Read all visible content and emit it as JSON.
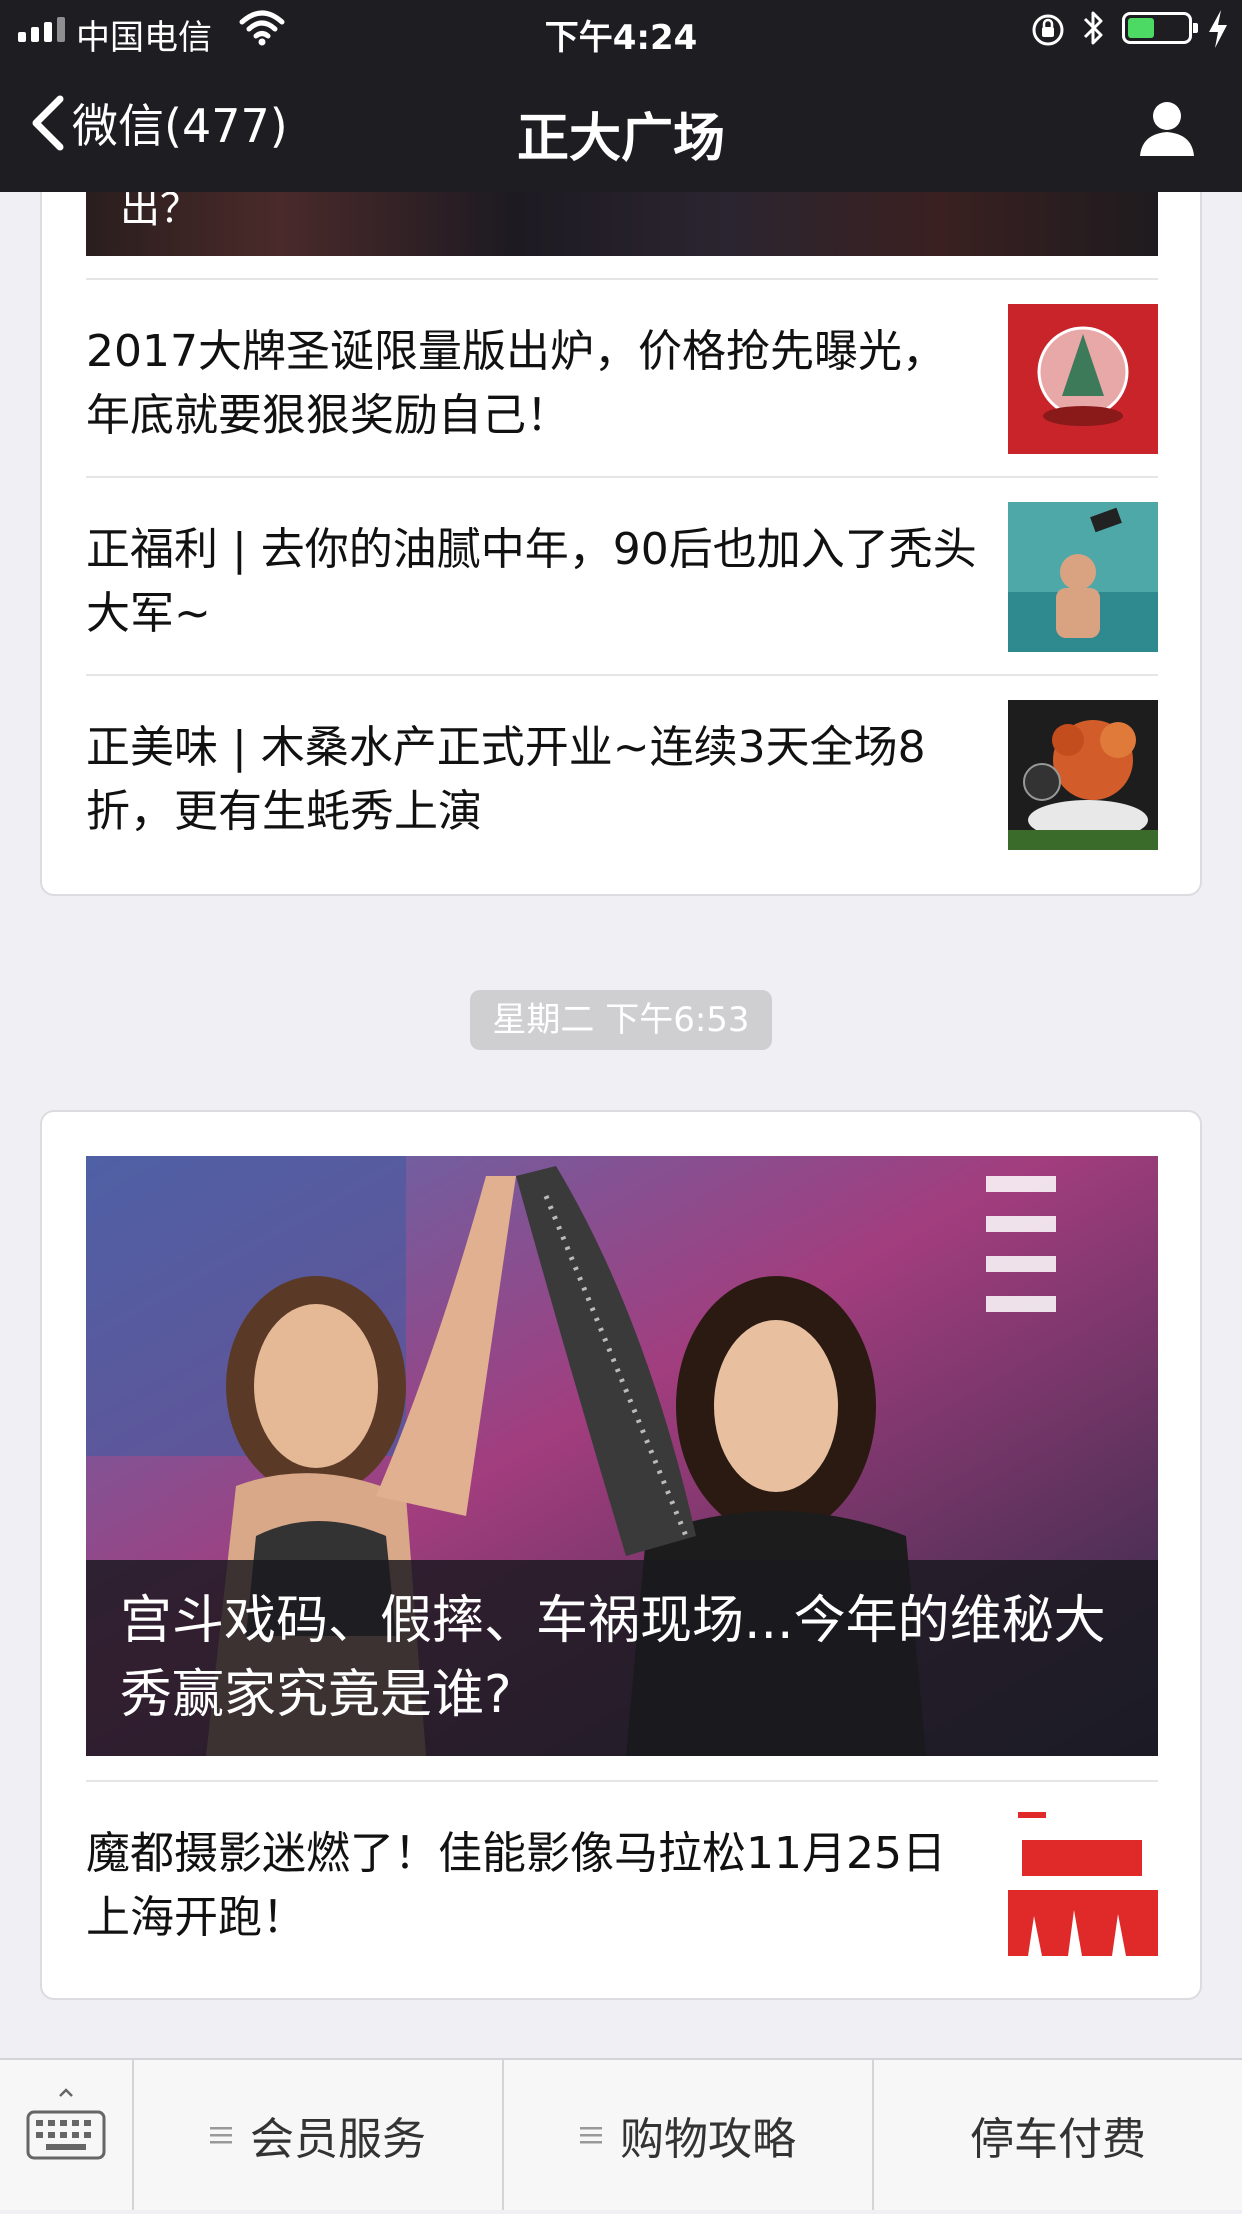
{
  "status_bar": {
    "carrier": "中国电信",
    "time": "下午4:24",
    "battery_level": 0.45
  },
  "nav": {
    "back_label": "微信(477)",
    "title": "正大广场"
  },
  "feed": {
    "card1": {
      "top_truncated": "出？",
      "items": [
        {
          "title": "2017大牌圣诞限量版出炉，价格抢先曝光，年底就要狠狠奖励自己！"
        },
        {
          "title": "正福利 | 去你的油腻中年，90后也加入了秃头大军~"
        },
        {
          "title": "正美味 | 木桑水产正式开业~连续3天全场8折，更有生蚝秀上演"
        }
      ]
    },
    "timestamp": "星期二 下午6:53",
    "card2": {
      "hero_title": "宫斗戏码、假摔、车祸现场...今年的维秘大秀赢家究竟是谁?",
      "items": [
        {
          "title": "魔都摄影迷燃了！佳能影像马拉松11月25日上海开跑！"
        }
      ]
    }
  },
  "bottom_menu": {
    "items": [
      {
        "label": "会员服务"
      },
      {
        "label": "购物攻略"
      },
      {
        "label": "停车付费"
      }
    ]
  },
  "colors": {
    "nav_bg": "#1e1e22",
    "page_bg": "#efeff4",
    "battery_green": "#4cd964"
  }
}
